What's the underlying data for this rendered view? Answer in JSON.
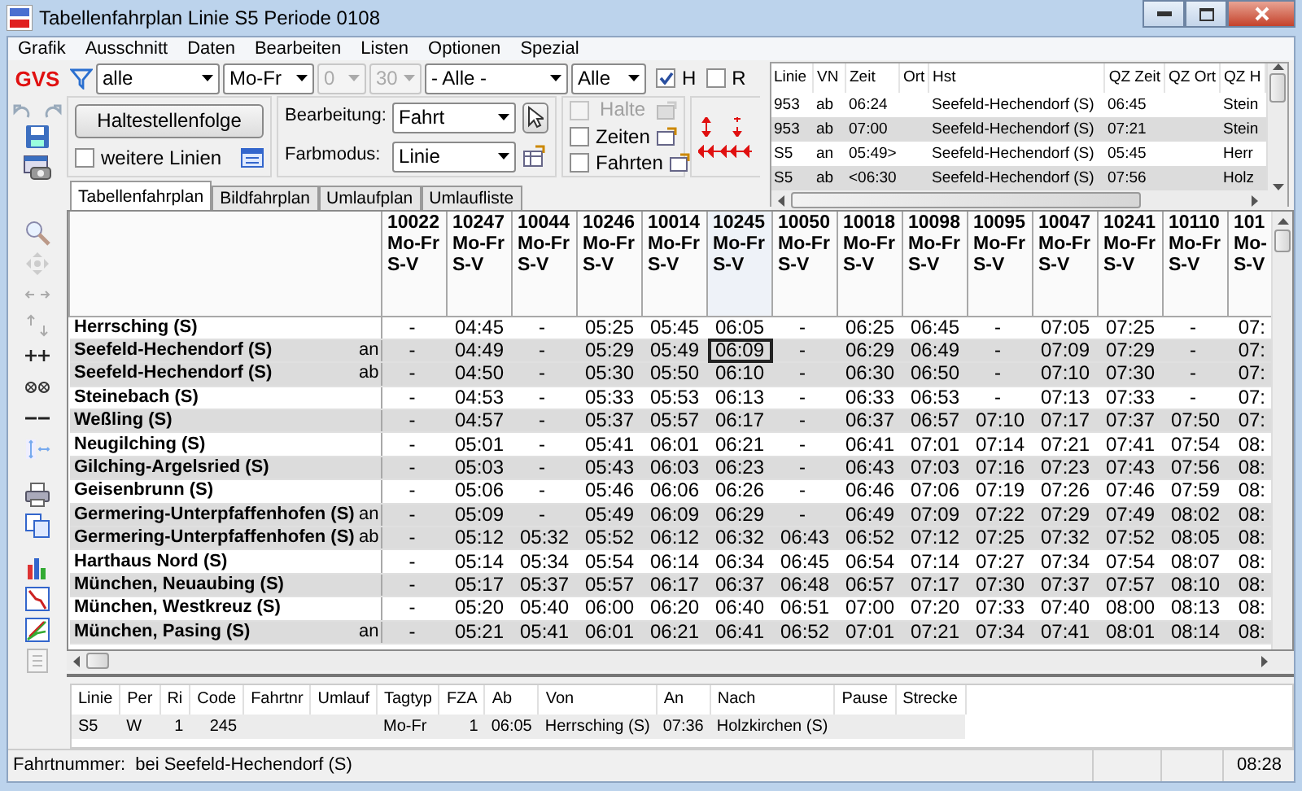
{
  "window": {
    "title": "Tabellenfahrplan Linie S5 Periode 0108",
    "app_logo": "GVS"
  },
  "menu": [
    "Grafik",
    "Ausschnitt",
    "Daten",
    "Bearbeiten",
    "Listen",
    "Optionen",
    "Spezial"
  ],
  "filters": [
    {
      "value": "alle",
      "disabled": false
    },
    {
      "value": "Mo-Fr",
      "disabled": false
    },
    {
      "value": "0",
      "disabled": true
    },
    {
      "value": "30",
      "disabled": true
    },
    {
      "value": "- Alle -",
      "disabled": false
    },
    {
      "value": "Alle",
      "disabled": false
    }
  ],
  "flags": [
    {
      "label": "H",
      "checked": true
    },
    {
      "label": "R",
      "checked": false
    }
  ],
  "route_button": "Haltestellenfolge",
  "more_lines": {
    "label": "weitere Linien",
    "checked": false
  },
  "edit_mode": {
    "label": "Bearbeitung:",
    "value": "Fahrt"
  },
  "color_mode": {
    "label": "Farbmodus:",
    "value": "Linie"
  },
  "display_options": [
    {
      "label": "Halte",
      "checked": false,
      "disabled": true
    },
    {
      "label": "Zeiten",
      "checked": false,
      "disabled": false
    },
    {
      "label": "Fahrten",
      "checked": false,
      "disabled": false
    }
  ],
  "tabs": [
    {
      "label": "Tabellenfahrplan",
      "selected": true
    },
    {
      "label": "Bildfahrplan",
      "selected": false
    },
    {
      "label": "Umlaufplan",
      "selected": false
    },
    {
      "label": "Umlaufliste",
      "selected": false
    }
  ],
  "connections": {
    "columns": [
      "Linie",
      "VN",
      "Zeit",
      "Ort",
      "Hst",
      "QZ Zeit",
      "QZ Ort",
      "QZ H"
    ],
    "rows": [
      [
        "953",
        "ab",
        "06:24",
        null,
        "Seefeld-Hechendorf (S)",
        "06:45",
        null,
        "Stein"
      ],
      [
        "953",
        "ab",
        "07:00",
        null,
        "Seefeld-Hechendorf (S)",
        "07:21",
        null,
        "Stein"
      ],
      [
        "S5",
        "an",
        "05:49>",
        null,
        "Seefeld-Hechendorf (S)",
        "05:45",
        null,
        "Herr"
      ],
      [
        "S5",
        "ab",
        "<06:30",
        null,
        "Seefeld-Hechendorf (S)",
        "07:56",
        null,
        "Holz"
      ]
    ]
  },
  "timetable": {
    "trips": [
      {
        "number": "10022",
        "days": "Mo-Fr",
        "type": "S-V",
        "selected": false
      },
      {
        "number": "10247",
        "days": "Mo-Fr",
        "type": "S-V",
        "selected": false
      },
      {
        "number": "10044",
        "days": "Mo-Fr",
        "type": "S-V",
        "selected": false
      },
      {
        "number": "10246",
        "days": "Mo-Fr",
        "type": "S-V",
        "selected": false
      },
      {
        "number": "10014",
        "days": "Mo-Fr",
        "type": "S-V",
        "selected": false
      },
      {
        "number": "10245",
        "days": "Mo-Fr",
        "type": "S-V",
        "selected": true
      },
      {
        "number": "10050",
        "days": "Mo-Fr",
        "type": "S-V",
        "selected": false
      },
      {
        "number": "10018",
        "days": "Mo-Fr",
        "type": "S-V",
        "selected": false
      },
      {
        "number": "10098",
        "days": "Mo-Fr",
        "type": "S-V",
        "selected": false
      },
      {
        "number": "10095",
        "days": "Mo-Fr",
        "type": "S-V",
        "selected": false
      },
      {
        "number": "10047",
        "days": "Mo-Fr",
        "type": "S-V",
        "selected": false
      },
      {
        "number": "10241",
        "days": "Mo-Fr",
        "type": "S-V",
        "selected": false
      },
      {
        "number": "10110",
        "days": "Mo-Fr",
        "type": "S-V",
        "selected": false
      },
      {
        "number": "101",
        "days": "Mo-",
        "type": "S-V",
        "selected": false
      }
    ],
    "rows": [
      {
        "station": "Herrsching (S)",
        "shaded": false,
        "selected": false,
        "times": [
          "-",
          "04:45",
          "-",
          "05:25",
          "05:45",
          "06:05",
          "-",
          "06:25",
          "06:45",
          "-",
          "07:05",
          "07:25",
          "-",
          "07:"
        ]
      },
      {
        "station": "Seefeld-Hechendorf (S)",
        "event": "an",
        "shaded": true,
        "selected": true,
        "times": [
          "-",
          "04:49",
          "-",
          "05:29",
          "05:49",
          "06:09",
          "-",
          "06:29",
          "06:49",
          "-",
          "07:09",
          "07:29",
          "-",
          "07:"
        ]
      },
      {
        "station": "Seefeld-Hechendorf (S)",
        "event": "ab",
        "shaded": true,
        "selected": false,
        "times": [
          "-",
          "04:50",
          "-",
          "05:30",
          "05:50",
          "06:10",
          "-",
          "06:30",
          "06:50",
          "-",
          "07:10",
          "07:30",
          "-",
          "07:"
        ]
      },
      {
        "station": "Steinebach (S)",
        "shaded": false,
        "selected": false,
        "times": [
          "-",
          "04:53",
          "-",
          "05:33",
          "05:53",
          "06:13",
          "-",
          "06:33",
          "06:53",
          "-",
          "07:13",
          "07:33",
          "-",
          "07:"
        ]
      },
      {
        "station": "Weßling (S)",
        "shaded": true,
        "selected": false,
        "times": [
          "-",
          "04:57",
          "-",
          "05:37",
          "05:57",
          "06:17",
          "-",
          "06:37",
          "06:57",
          "07:10",
          "07:17",
          "07:37",
          "07:50",
          "07:"
        ]
      },
      {
        "station": "Neugilching (S)",
        "shaded": false,
        "selected": false,
        "times": [
          "-",
          "05:01",
          "-",
          "05:41",
          "06:01",
          "06:21",
          "-",
          "06:41",
          "07:01",
          "07:14",
          "07:21",
          "07:41",
          "07:54",
          "08:"
        ]
      },
      {
        "station": "Gilching-Argelsried (S)",
        "shaded": true,
        "selected": false,
        "times": [
          "-",
          "05:03",
          "-",
          "05:43",
          "06:03",
          "06:23",
          "-",
          "06:43",
          "07:03",
          "07:16",
          "07:23",
          "07:43",
          "07:56",
          "08:"
        ]
      },
      {
        "station": "Geisenbrunn (S)",
        "shaded": false,
        "selected": false,
        "times": [
          "-",
          "05:06",
          "-",
          "05:46",
          "06:06",
          "06:26",
          "-",
          "06:46",
          "07:06",
          "07:19",
          "07:26",
          "07:46",
          "07:59",
          "08:"
        ]
      },
      {
        "station": "Germering-Unterpfaffenhofen (S)",
        "event": "an",
        "shaded": true,
        "selected": false,
        "times": [
          "-",
          "05:09",
          "-",
          "05:49",
          "06:09",
          "06:29",
          "-",
          "06:49",
          "07:09",
          "07:22",
          "07:29",
          "07:49",
          "08:02",
          "08:"
        ]
      },
      {
        "station": "Germering-Unterpfaffenhofen (S)",
        "event": "ab",
        "shaded": true,
        "selected": false,
        "times": [
          "-",
          "05:12",
          "05:32",
          "05:52",
          "06:12",
          "06:32",
          "06:43",
          "06:52",
          "07:12",
          "07:25",
          "07:32",
          "07:52",
          "08:05",
          "08:"
        ]
      },
      {
        "station": "Harthaus Nord (S)",
        "shaded": false,
        "selected": false,
        "times": [
          "-",
          "05:14",
          "05:34",
          "05:54",
          "06:14",
          "06:34",
          "06:45",
          "06:54",
          "07:14",
          "07:27",
          "07:34",
          "07:54",
          "08:07",
          "08:"
        ]
      },
      {
        "station": "München, Neuaubing (S)",
        "shaded": true,
        "selected": false,
        "times": [
          "-",
          "05:17",
          "05:37",
          "05:57",
          "06:17",
          "06:37",
          "06:48",
          "06:57",
          "07:17",
          "07:30",
          "07:37",
          "07:57",
          "08:10",
          "08:"
        ]
      },
      {
        "station": "München, Westkreuz (S)",
        "shaded": false,
        "selected": false,
        "times": [
          "-",
          "05:20",
          "05:40",
          "06:00",
          "06:20",
          "06:40",
          "06:51",
          "07:00",
          "07:20",
          "07:33",
          "07:40",
          "08:00",
          "08:13",
          "08:"
        ]
      },
      {
        "station": "München, Pasing (S)",
        "event": "an",
        "shaded": true,
        "selected": false,
        "times": [
          "-",
          "05:21",
          "05:41",
          "06:01",
          "06:21",
          "06:41",
          "06:52",
          "07:01",
          "07:21",
          "07:34",
          "07:41",
          "08:01",
          "08:14",
          "08:"
        ]
      }
    ]
  },
  "details": {
    "columns": [
      "Linie",
      "Per",
      "Ri",
      "Code",
      "Fahrtnr",
      "Umlauf",
      "Tagtyp",
      "FZA",
      "Ab",
      "Von",
      "An",
      "Nach",
      "Pause",
      "Strecke"
    ],
    "rows": [
      [
        "S5",
        "W",
        "1",
        "245",
        null,
        null,
        "Mo-Fr",
        "1",
        "06:05",
        "Herrsching (S)",
        "07:36",
        "Holzkirchen (S)",
        null,
        null
      ]
    ]
  },
  "status_bar": {
    "label": "Fahrtnummer:",
    "value": "bei Seefeld-Hechendorf (S)",
    "time": "08:28"
  }
}
